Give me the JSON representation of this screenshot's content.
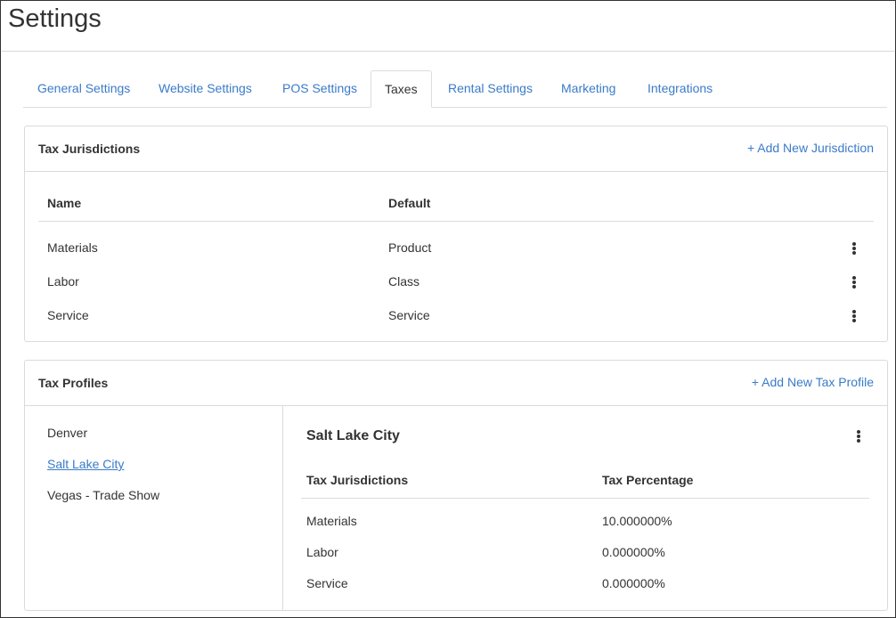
{
  "page": {
    "title": "Settings"
  },
  "tabs": [
    {
      "label": "General Settings"
    },
    {
      "label": "Website Settings"
    },
    {
      "label": "POS Settings"
    },
    {
      "label": "Taxes",
      "active": true
    },
    {
      "label": "Rental Settings"
    },
    {
      "label": "Marketing"
    },
    {
      "label": "Integrations"
    }
  ],
  "jurisdictions": {
    "title": "Tax Jurisdictions",
    "add_label": "+ Add New Jurisdiction",
    "columns": {
      "name": "Name",
      "default": "Default"
    },
    "rows": [
      {
        "name": "Materials",
        "default": "Product"
      },
      {
        "name": "Labor",
        "default": "Class"
      },
      {
        "name": "Service",
        "default": "Service"
      }
    ]
  },
  "profiles": {
    "title": "Tax Profiles",
    "add_label": "+ Add New Tax Profile",
    "list": [
      {
        "label": "Denver"
      },
      {
        "label": "Salt Lake City",
        "selected": true
      },
      {
        "label": "Vegas - Trade Show"
      }
    ],
    "detail": {
      "title": "Salt Lake City",
      "columns": {
        "jurisdiction": "Tax Jurisdictions",
        "percentage": "Tax Percentage"
      },
      "rows": [
        {
          "jurisdiction": "Materials",
          "percentage": "10.000000%"
        },
        {
          "jurisdiction": "Labor",
          "percentage": "0.000000%"
        },
        {
          "jurisdiction": "Service",
          "percentage": "0.000000%"
        }
      ]
    }
  },
  "colors": {
    "link": "#3a7bc8",
    "text": "#333333",
    "border": "#dadada"
  },
  "icons": {
    "row_menu": "kebab-menu-icon"
  }
}
